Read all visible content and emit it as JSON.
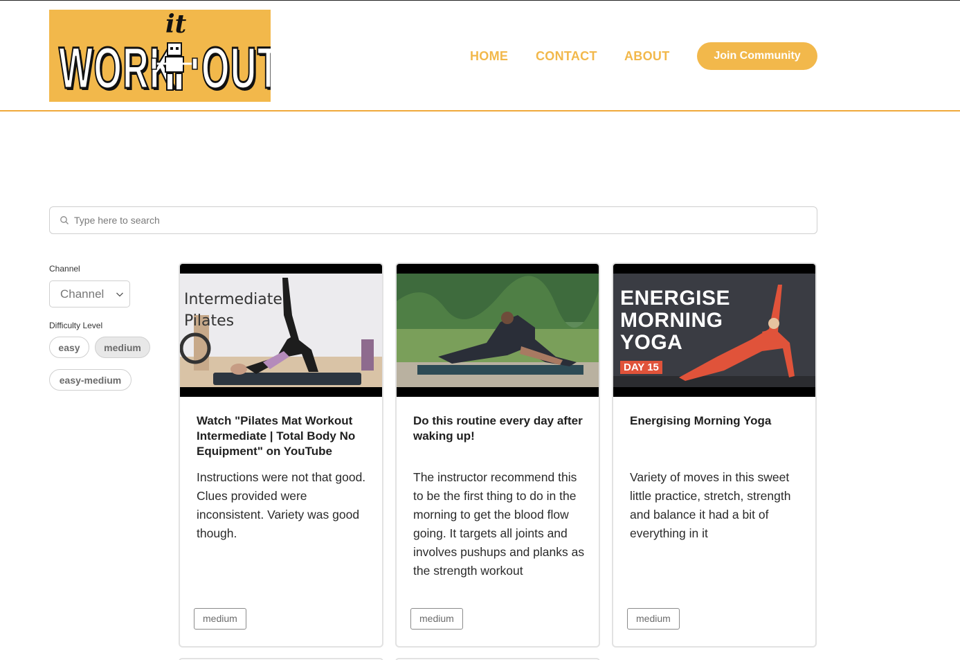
{
  "brand": {
    "logo_top": "it",
    "logo_left": "WORK",
    "logo_right": "OUT",
    "colors": {
      "accent": "#f2b84b",
      "rule": "#f0a93a"
    }
  },
  "nav": {
    "links": [
      "HOME",
      "CONTACT",
      "ABOUT"
    ],
    "cta": "Join Community"
  },
  "search": {
    "placeholder": "Type here to search",
    "value": ""
  },
  "filters": {
    "channel_label": "Channel",
    "channel_value": "Channel",
    "difficulty_label": "Difficulty Level",
    "difficulty_options": [
      {
        "label": "easy",
        "selected": false
      },
      {
        "label": "medium",
        "selected": true
      },
      {
        "label": "easy-medium",
        "selected": false
      }
    ]
  },
  "cards": [
    {
      "thumb_text": "Intermediate\nPilates",
      "title": "Watch \"Pilates Mat Workout Intermediate | Total Body No Equipment\" on YouTube",
      "description": "Instructions were not that good. Clues provided were inconsistent. Variety was good though.",
      "tag": "medium"
    },
    {
      "thumb_text": "",
      "title": "Do this routine every day after waking up!",
      "description": "The instructor recommend this to be the first thing to do in the morning to get the blood flow going. It targets all joints and involves pushups and planks as the strength workout",
      "tag": "medium"
    },
    {
      "thumb_text": "ENERGISE MORNING YOGA",
      "thumb_badge": "DAY 15",
      "title": "Energising Morning Yoga",
      "description": "Variety of moves in this sweet little practice, stretch, strength and balance it had a bit of everything in it",
      "tag": "medium"
    }
  ]
}
